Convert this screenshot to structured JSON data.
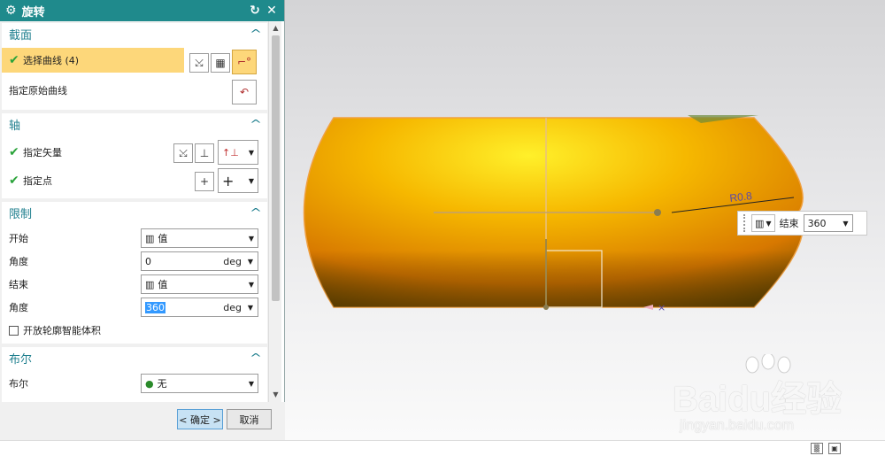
{
  "dialog": {
    "title": "旋转",
    "section_label": "截面",
    "select_curve": "选择曲线 (4)",
    "specify_origin_curve": "指定原始曲线",
    "axis_label": "轴",
    "specify_vector": "指定矢量",
    "specify_point": "指定点",
    "limits_label": "限制",
    "start_label": "开始",
    "start_option": "值",
    "angle_label_1": "角度",
    "angle_value_1": "0",
    "angle_unit_1": "deg",
    "end_label": "结束",
    "end_option": "值",
    "angle_label_2": "角度",
    "angle_value_2": "360",
    "angle_unit_2": "deg",
    "open_profile": "开放轮廓智能体积",
    "boolean_section": "布尔",
    "boolean_label": "布尔",
    "boolean_option": "无",
    "ok_button": "< 确定 >",
    "cancel_button": "取消"
  },
  "viewport": {
    "dimension_text": "R0.8",
    "float_end_label": "结束",
    "float_end_value": "360"
  },
  "watermark": {
    "logo": "Baidu经验",
    "url": "jingyan.baidu.com"
  },
  "colors": {
    "title_bar": "#1f8a8c",
    "highlight": "#fdd77a",
    "body_orange": "#f5a000"
  }
}
